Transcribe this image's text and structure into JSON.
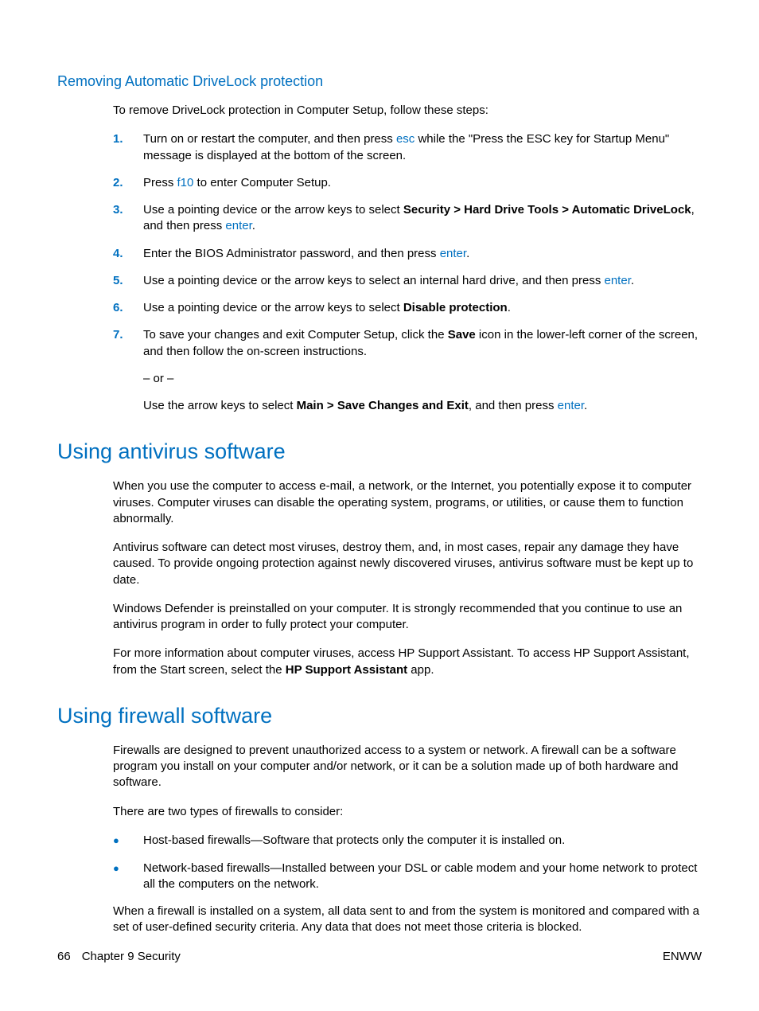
{
  "section1": {
    "heading": "Removing Automatic DriveLock protection",
    "intro": "To remove DriveLock protection in Computer Setup, follow these steps:",
    "steps": [
      {
        "num": "1.",
        "pre": "Turn on or restart the computer, and then press ",
        "key": "esc",
        "post": " while the \"Press the ESC key for Startup Menu\" message is displayed at the bottom of the screen."
      },
      {
        "num": "2.",
        "pre": "Press ",
        "key": "f10",
        "post": " to enter Computer Setup."
      },
      {
        "num": "3.",
        "pre": "Use a pointing device or the arrow keys to select ",
        "bold": "Security > Hard Drive Tools > Automatic DriveLock",
        "mid": ", and then press ",
        "key": "enter",
        "post": "."
      },
      {
        "num": "4.",
        "pre": "Enter the BIOS Administrator password, and then press ",
        "key": "enter",
        "post": "."
      },
      {
        "num": "5.",
        "pre": "Use a pointing device or the arrow keys to select an internal hard drive, and then press ",
        "key": "enter",
        "post": "."
      },
      {
        "num": "6.",
        "pre": "Use a pointing device or the arrow keys to select ",
        "bold": "Disable protection",
        "post": "."
      },
      {
        "num": "7.",
        "pre": "To save your changes and exit Computer Setup, click the ",
        "bold": "Save",
        "post": " icon in the lower-left corner of the screen, and then follow the on-screen instructions.",
        "or": "– or –",
        "sub_pre": "Use the arrow keys to select ",
        "sub_bold": "Main > Save Changes and Exit",
        "sub_mid": ", and then press ",
        "sub_key": "enter",
        "sub_post": "."
      }
    ]
  },
  "section2": {
    "heading": "Using antivirus software",
    "paragraphs": [
      {
        "text": "When you use the computer to access e-mail, a network, or the Internet, you potentially expose it to computer viruses. Computer viruses can disable the operating system, programs, or utilities, or cause them to function abnormally."
      },
      {
        "text": "Antivirus software can detect most viruses, destroy them, and, in most cases, repair any damage they have caused. To provide ongoing protection against newly discovered viruses, antivirus software must be kept up to date."
      },
      {
        "text": "Windows Defender is preinstalled on your computer. It is strongly recommended that you continue to use an antivirus program in order to fully protect your computer."
      },
      {
        "pre": "For more information about computer viruses, access HP Support Assistant. To access HP Support Assistant, from the Start screen, select the ",
        "bold": "HP Support Assistant",
        "post": " app."
      }
    ]
  },
  "section3": {
    "heading": "Using firewall software",
    "para1": "Firewalls are designed to prevent unauthorized access to a system or network. A firewall can be a software program you install on your computer and/or network, or it can be a solution made up of both hardware and software.",
    "para2": "There are two types of firewalls to consider:",
    "bullets": [
      "Host-based firewalls—Software that protects only the computer it is installed on.",
      "Network-based firewalls—Installed between your DSL or cable modem and your home network to protect all the computers on the network."
    ],
    "para3": "When a firewall is installed on a system, all data sent to and from the system is monitored and compared with a set of user-defined security criteria. Any data that does not meet those criteria is blocked."
  },
  "footer": {
    "page": "66",
    "chapter": "Chapter 9   Security",
    "right": "ENWW"
  }
}
